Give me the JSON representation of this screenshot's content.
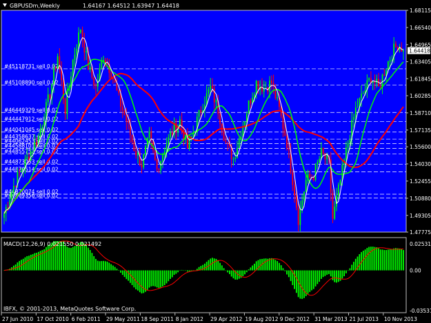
{
  "window": {
    "symbol_timeframe": "GBPUSDm,Weekly",
    "ohlc": "1.64167 1.64512 1.63947 1.64418"
  },
  "colors": {
    "background": "#000000",
    "main_panel": "#0000ff",
    "bull_candle": "#00ff00",
    "bear_candle": "#ff0000",
    "ma_slow": "#ff0000",
    "ma_fast": "#00ff00",
    "ma_white": "#ffffff",
    "macd_histogram": "#00ff00",
    "macd_signal": "#ff0000",
    "order_line": "#ffffff",
    "price_tag": "#ffffff"
  },
  "price_axis": {
    "labels": [
      "1.68115",
      "1.66540",
      "1.64965",
      "1.63405",
      "1.61845",
      "1.60285",
      "1.58710",
      "1.57135",
      "1.55600",
      "1.54030",
      "1.52455",
      "1.50880",
      "1.49305",
      "1.47775"
    ],
    "current_price": "1.64418"
  },
  "macd_panel": {
    "title": "MACD(12,26,9) 0.021550 0.021492",
    "axis_labels": [
      "0.025313",
      "0.00",
      "-0.035314"
    ]
  },
  "date_axis": {
    "labels": [
      "27 Jun 2010",
      "17 Oct 2010",
      "6 Feb 2011",
      "29 May 2011",
      "18 Sep 2011",
      "8 Jan 2012",
      "29 Apr 2012",
      "19 Aug 2012",
      "9 Dec 2012",
      "31 Mar 2013",
      "21 Jul 2013",
      "10 Nov 2013"
    ]
  },
  "orders": [
    {
      "label": "#45118731 sell 0.02",
      "price": 1.6275
    },
    {
      "label": "#45108890 sell 0.02",
      "price": 1.6125
    },
    {
      "label": "#46449329 sell 0.02",
      "price": 1.5875
    },
    {
      "label": "#44447912 sell 0.02",
      "price": 1.579
    },
    {
      "label": "#44041045 sell 0.02",
      "price": 1.5695
    },
    {
      "label": "#44358637 sell 0.02",
      "price": 1.563
    },
    {
      "label": "#44062453 sell 0.02",
      "price": 1.559
    },
    {
      "label": "#44588101 sell 0.02",
      "price": 1.5545
    },
    {
      "label": "#44855752 sell 0.02",
      "price": 1.5495
    },
    {
      "label": "#44873033 sell 0.02",
      "price": 1.54
    },
    {
      "label": "#44870514 sell 0.02",
      "price": 1.533
    },
    {
      "label": "#44870074 sell 0.02",
      "price": 1.5125
    },
    {
      "label": "#44869356 sell 0.02",
      "price": 1.509
    }
  ],
  "footer": {
    "copyright": "IBFX, © 2001-2013, MetaQuotes Software Corp."
  },
  "chart_data": {
    "type": "candlestick",
    "symbol": "GBPUSDm",
    "timeframe": "Weekly",
    "ylim": [
      1.47775,
      1.68115
    ],
    "close_anchors": [
      [
        0,
        1.495
      ],
      [
        6,
        1.525
      ],
      [
        12,
        1.545
      ],
      [
        18,
        1.565
      ],
      [
        24,
        1.605
      ],
      [
        28,
        1.64
      ],
      [
        32,
        1.59
      ],
      [
        36,
        1.635
      ],
      [
        40,
        1.665
      ],
      [
        44,
        1.63
      ],
      [
        48,
        1.61
      ],
      [
        52,
        1.64
      ],
      [
        56,
        1.625
      ],
      [
        60,
        1.6
      ],
      [
        64,
        1.58
      ],
      [
        68,
        1.555
      ],
      [
        72,
        1.54
      ],
      [
        76,
        1.565
      ],
      [
        80,
        1.535
      ],
      [
        84,
        1.555
      ],
      [
        88,
        1.57
      ],
      [
        92,
        1.58
      ],
      [
        96,
        1.555
      ],
      [
        100,
        1.575
      ],
      [
        104,
        1.595
      ],
      [
        108,
        1.61
      ],
      [
        112,
        1.59
      ],
      [
        116,
        1.56
      ],
      [
        120,
        1.545
      ],
      [
        124,
        1.57
      ],
      [
        128,
        1.595
      ],
      [
        132,
        1.615
      ],
      [
        136,
        1.61
      ],
      [
        140,
        1.615
      ],
      [
        144,
        1.59
      ],
      [
        148,
        1.56
      ],
      [
        152,
        1.515
      ],
      [
        154,
        1.49
      ],
      [
        158,
        1.525
      ],
      [
        162,
        1.53
      ],
      [
        166,
        1.55
      ],
      [
        170,
        1.54
      ],
      [
        172,
        1.49
      ],
      [
        176,
        1.525
      ],
      [
        180,
        1.56
      ],
      [
        184,
        1.59
      ],
      [
        188,
        1.605
      ],
      [
        192,
        1.62
      ],
      [
        196,
        1.61
      ],
      [
        200,
        1.63
      ],
      [
        204,
        1.645
      ],
      [
        206,
        1.65
      ],
      [
        210,
        1.644
      ]
    ],
    "n_bars": 210,
    "macd_range": [
      -0.035314,
      0.025313
    ]
  }
}
